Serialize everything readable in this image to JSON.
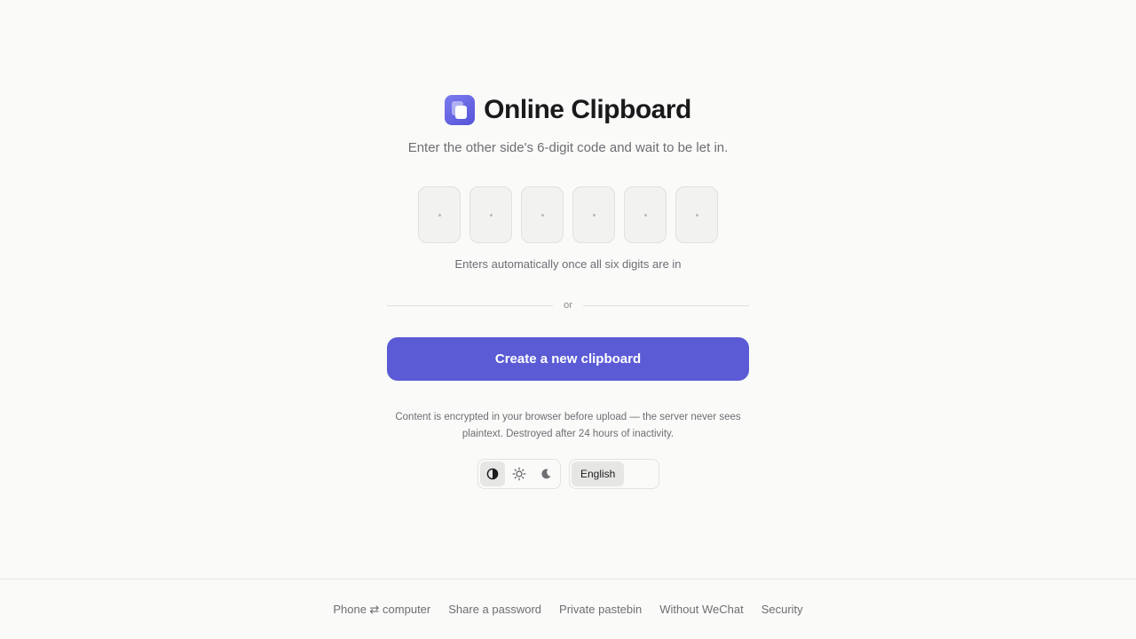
{
  "brand": {
    "title": "Online Clipboard",
    "logo_icon": "clipboard-stack-icon",
    "accent_color": "#5b5bd6"
  },
  "join": {
    "subtitle": "Enter the other side's 6-digit code and wait to be let in.",
    "digits": [
      "",
      "",
      "",
      "",
      "",
      ""
    ],
    "hint": "Enters automatically once all six digits are in"
  },
  "divider": {
    "label": "or"
  },
  "create": {
    "label": "Create a new clipboard"
  },
  "note": "Content is encrypted in your browser before upload — the server never sees plaintext. Destroyed after 24 hours of inactivity.",
  "theme": {
    "options": [
      {
        "icon": "contrast-icon",
        "selected": true
      },
      {
        "icon": "sun-icon",
        "selected": false
      },
      {
        "icon": "moon-icon",
        "selected": false
      }
    ]
  },
  "language": {
    "selected": "English"
  },
  "footer": {
    "links": [
      "Phone ⇄ computer",
      "Share a password",
      "Private pastebin",
      "Without WeChat",
      "Security"
    ]
  }
}
